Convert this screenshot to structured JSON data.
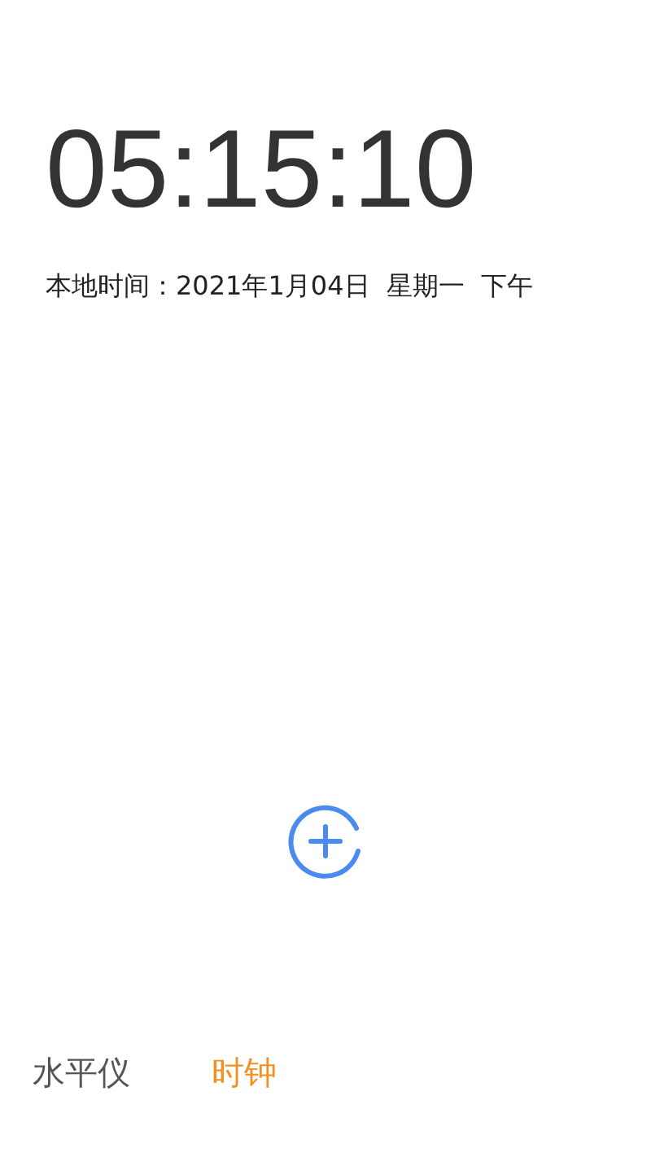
{
  "clock": {
    "time": "05:15:10",
    "local_date": "本地时间：2021年1月04日  星期一  下午"
  },
  "tabs": [
    {
      "label": "水平仪",
      "selected": false
    },
    {
      "label": "时钟",
      "selected": true
    }
  ]
}
